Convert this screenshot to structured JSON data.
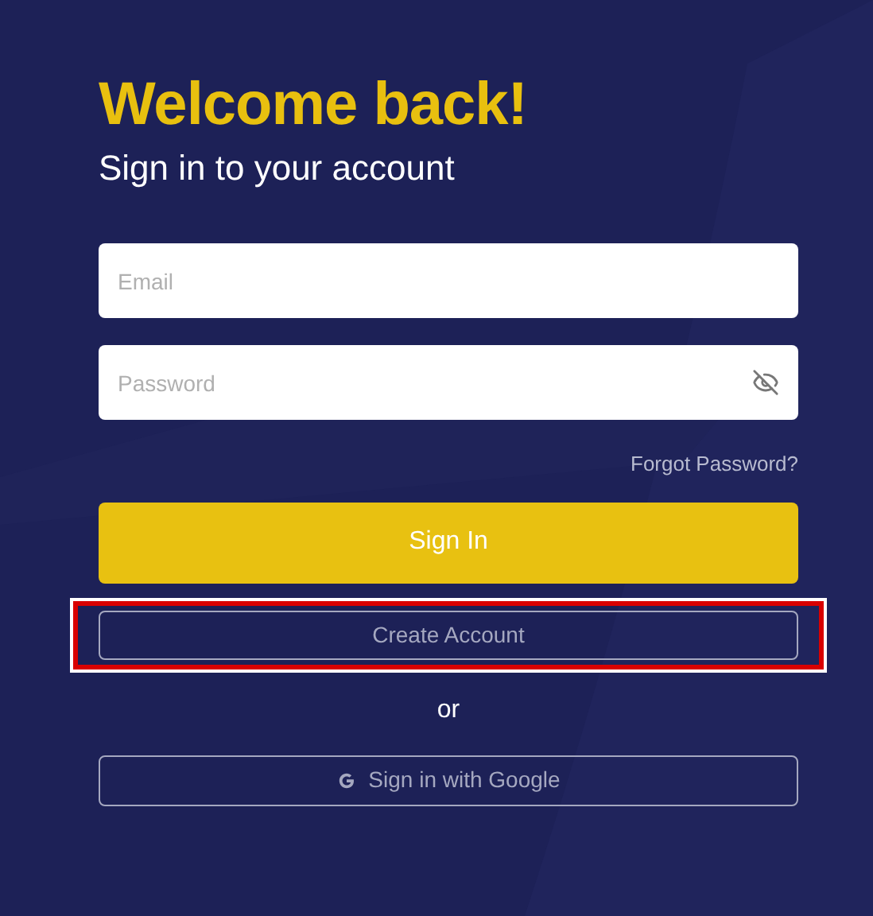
{
  "heading": "Welcome back!",
  "subheading": "Sign in to your account",
  "email": {
    "placeholder": "Email"
  },
  "password": {
    "placeholder": "Password",
    "visible": false
  },
  "forgot_link": "Forgot Password?",
  "sign_in_button": "Sign In",
  "create_account_button": {
    "label": "Create Account",
    "highlighted": true
  },
  "separator": "or",
  "google_button": "Sign in with Google"
}
